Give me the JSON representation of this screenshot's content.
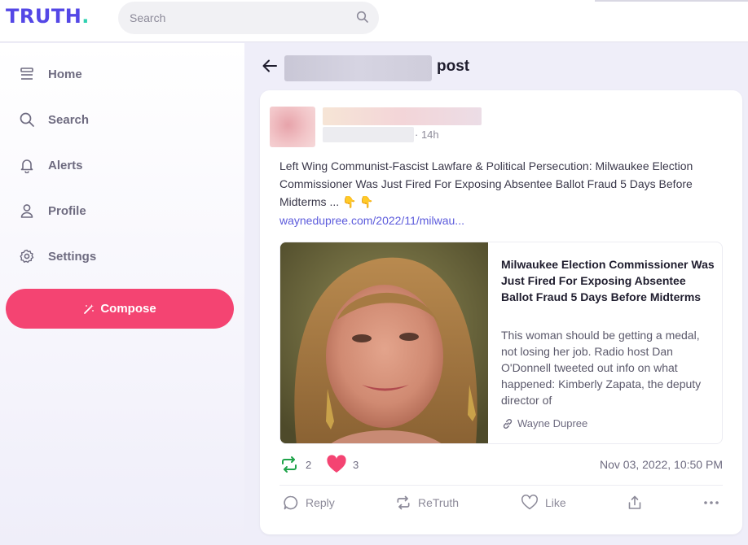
{
  "brand": {
    "logo_text": "TRUTH",
    "logo_dot": ".",
    "logo_color": "#5447e6",
    "dot_color": "#2fd1b0"
  },
  "search": {
    "placeholder": "Search",
    "icon": "search-icon"
  },
  "sidebar": {
    "items": [
      {
        "label": "Home",
        "icon": "home-icon"
      },
      {
        "label": "Search",
        "icon": "search-icon"
      },
      {
        "label": "Alerts",
        "icon": "bell-icon"
      },
      {
        "label": "Profile",
        "icon": "user-icon"
      },
      {
        "label": "Settings",
        "icon": "gear-icon"
      }
    ],
    "compose_label": "Compose",
    "compose_color": "#f44472"
  },
  "header": {
    "title_suffix": "post"
  },
  "post": {
    "time": "· 14h",
    "text": "Left Wing Communist-Fascist Lawfare & Political Persecution: Milwaukee Election Commissioner Was Just Fired For Exposing Absentee Ballot Fraud 5 Days Before Midterms ... 👇 👇",
    "link": "waynedupree.com/2022/11/milwau...",
    "preview": {
      "title": "Milwaukee Election Commissioner Was Just Fired For Exposing Absentee Ballot Fraud 5 Days Before Midterms",
      "description": "This woman should be getting a medal, not losing her job. Radio host Dan O'Donnell tweeted out info on what happened: Kimberly Zapata, the deputy director of",
      "source": "Wayne Dupree"
    },
    "retruths": "2",
    "likes": "3",
    "date": "Nov 03, 2022, 10:50 PM",
    "actions": {
      "reply": "Reply",
      "retruth": "ReTruth",
      "like": "Like"
    },
    "retruth_color": "#1fa34a",
    "like_color": "#f44472"
  }
}
